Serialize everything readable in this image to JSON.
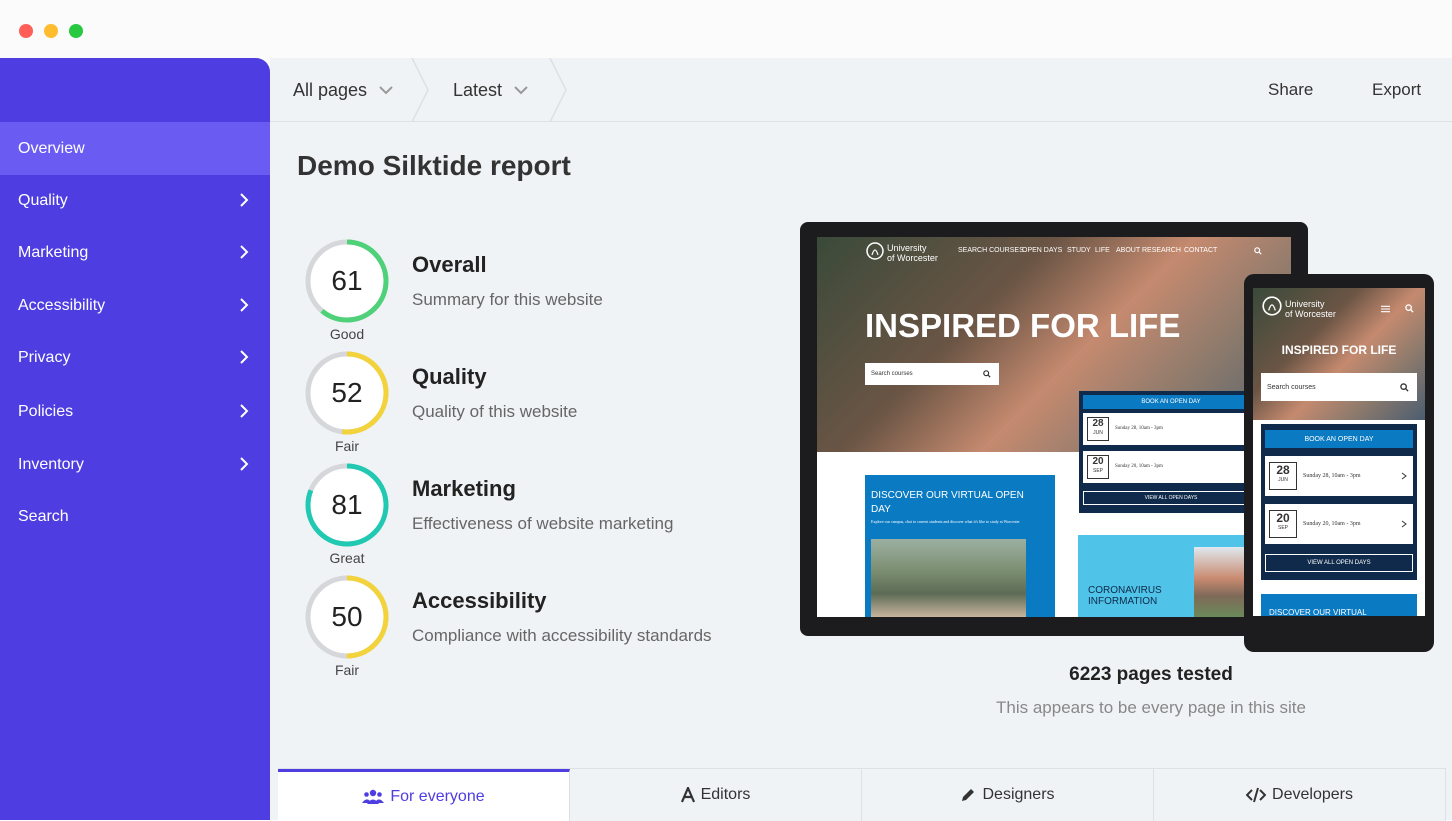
{
  "sidebar": {
    "items": [
      {
        "label": "Overview",
        "active": true,
        "has_chevron": false
      },
      {
        "label": "Quality",
        "has_chevron": true
      },
      {
        "label": "Marketing",
        "has_chevron": true
      },
      {
        "label": "Accessibility",
        "has_chevron": true
      },
      {
        "label": "Privacy",
        "has_chevron": true
      },
      {
        "label": "Policies",
        "has_chevron": true
      },
      {
        "label": "Inventory",
        "has_chevron": true
      },
      {
        "label": "Search",
        "has_chevron": false
      }
    ]
  },
  "topbar": {
    "filter_pages": "All pages",
    "filter_version": "Latest",
    "share_label": "Share",
    "export_label": "Export"
  },
  "report": {
    "title": "Demo Silktide report",
    "scores": [
      {
        "value": "61",
        "rating": "Good",
        "title": "Overall",
        "description": "Summary for this website",
        "fraction": 0.61,
        "color": "#4fd17a"
      },
      {
        "value": "52",
        "rating": "Fair",
        "title": "Quality",
        "description": "Quality of this website",
        "fraction": 0.52,
        "color": "#f2d33b"
      },
      {
        "value": "81",
        "rating": "Great",
        "title": "Marketing",
        "description": "Effectiveness of website marketing",
        "fraction": 0.81,
        "color": "#21c9b3"
      },
      {
        "value": "50",
        "rating": "Fair",
        "title": "Accessibility",
        "description": "Compliance with accessibility standards",
        "fraction": 0.5,
        "color": "#f2d33b"
      }
    ],
    "pages_tested": "6223 pages tested",
    "pages_note": "This appears to be every page in this site"
  },
  "preview": {
    "site_logo_line1": "University",
    "site_logo_line2": "of Worcester",
    "nav_items": [
      "SEARCH COURSES",
      "OPEN DAYS",
      "STUDY",
      "LIFE",
      "ABOUT",
      "RESEARCH",
      "CONTACT"
    ],
    "hero_title": "INSPIRED FOR LIFE",
    "search_placeholder": "Search courses",
    "book_open_day": "BOOK AN OPEN DAY",
    "open_days": [
      {
        "day": "28",
        "month": "JUN",
        "text": "Sunday 28, 10am - 3pm"
      },
      {
        "day": "20",
        "month": "SEP",
        "text": "Sunday 20, 10am - 3pm"
      }
    ],
    "view_all": "VIEW ALL OPEN DAYS",
    "virtual_title": "DISCOVER OUR VIRTUAL OPEN DAY",
    "virtual_text": "Explore our campus, chat to current students and discover what it's like to study at Worcester",
    "corona_title": "CORONAVIRUS INFORMATION",
    "phone_virtual": "DISCOVER OUR VIRTUAL"
  },
  "tabs": [
    {
      "label": "For everyone",
      "icon": "users-icon",
      "active": true
    },
    {
      "label": "Editors",
      "icon": "font-icon",
      "active": false
    },
    {
      "label": "Designers",
      "icon": "pencil-icon",
      "active": false
    },
    {
      "label": "Developers",
      "icon": "code-icon",
      "active": false
    }
  ],
  "colors": {
    "sidebar": "#4e3de0",
    "sidebar_active": "#6a5cf2",
    "accent": "#4e3de0"
  }
}
